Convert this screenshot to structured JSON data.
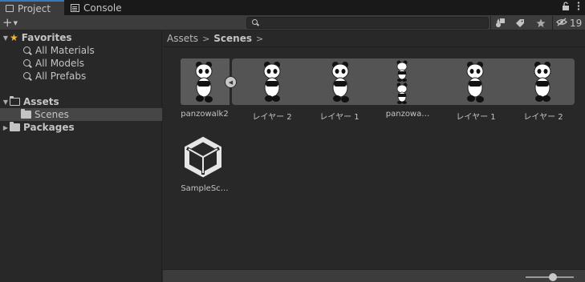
{
  "tabs": [
    {
      "label": "Project",
      "icon": "folder-icon",
      "active": true
    },
    {
      "label": "Console",
      "icon": "console-icon",
      "active": false
    }
  ],
  "window_buttons": {
    "lock": "🔓",
    "menu": "⋮"
  },
  "toolbar": {
    "add_label": "+",
    "search_placeholder": "",
    "hidden_count": "19"
  },
  "tree": {
    "favorites": {
      "label": "Favorites",
      "items": [
        "All Materials",
        "All Models",
        "All Prefabs"
      ]
    },
    "assets": {
      "label": "Assets",
      "children": [
        "Scenes"
      ]
    },
    "packages": {
      "label": "Packages"
    }
  },
  "breadcrumb": {
    "root": "Assets",
    "current": "Scenes"
  },
  "assets": [
    {
      "label": "panzowalk2"
    },
    {
      "label": "レイヤー 2"
    },
    {
      "label": "レイヤー 1"
    },
    {
      "label": "panzowa…"
    },
    {
      "label": "レイヤー 1"
    },
    {
      "label": "レイヤー 2"
    },
    {
      "label": "SampleSc…"
    }
  ],
  "colors": {
    "accent": "#3a79bb",
    "star": "#f5b92e",
    "background": "#282828",
    "toolbar": "#3c3c3c"
  }
}
